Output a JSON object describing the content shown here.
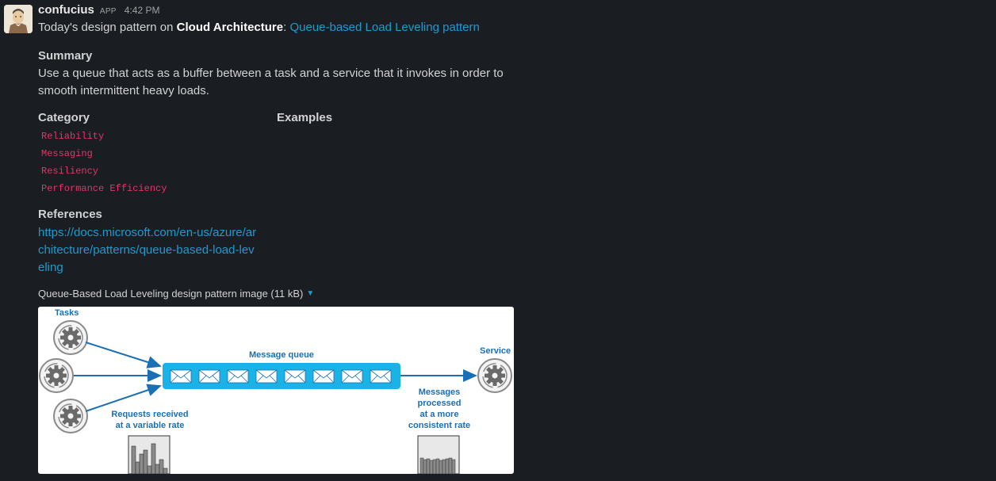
{
  "message": {
    "sender": "confucius",
    "badge": "APP",
    "time": "4:42 PM",
    "intro": "Today's design pattern on ",
    "intro_bold": "Cloud Architecture",
    "intro_sep": ": ",
    "pattern_link": "Queue-based Load Leveling pattern"
  },
  "summary": {
    "title": "Summary",
    "text": "Use a queue that acts as a buffer between a task and a service that it invokes in order to smooth intermittent heavy loads."
  },
  "category": {
    "title": "Category",
    "items": [
      "Reliability",
      "Messaging",
      "Resiliency",
      "Performance Efficiency"
    ]
  },
  "examples": {
    "title": "Examples"
  },
  "references": {
    "title": "References",
    "link": "https://docs.microsoft.com/en-us/azure/architecture/patterns/queue-based-load-leveling"
  },
  "attachment": {
    "caption": "Queue-Based Load Leveling design pattern image (11 kB)"
  },
  "diagram": {
    "tasks_label": "Tasks",
    "queue_label": "Message queue",
    "service_label": "Service",
    "requests_label_1": "Requests received",
    "requests_label_2": "at a variable rate",
    "processed_label_1": "Messages",
    "processed_label_2": "processed",
    "processed_label_3": "at a more",
    "processed_label_4": "consistent rate",
    "accent_color": "#1a6fb5",
    "queue_color": "#1ab3e6"
  },
  "colors": {
    "background": "#1a1d21",
    "link": "#1d9bd1",
    "code": "#e8336a"
  }
}
